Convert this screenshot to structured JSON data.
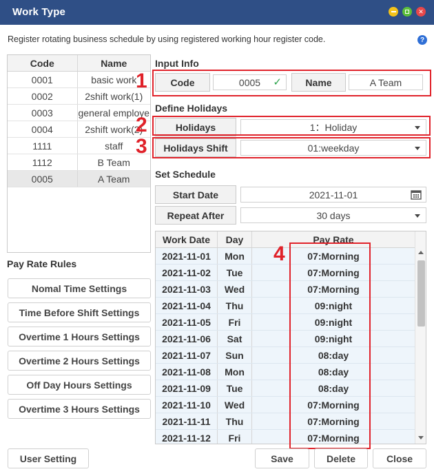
{
  "window": {
    "title": "Work Type"
  },
  "description": "Register rotating business schedule by using registered working hour register code.",
  "help_icon": "?",
  "code_list": {
    "headers": [
      "Code",
      "Name"
    ],
    "rows": [
      [
        "0001",
        "basic work"
      ],
      [
        "0002",
        "2shift work(1)"
      ],
      [
        "0003",
        "general employe"
      ],
      [
        "0004",
        "2shift work(2)"
      ],
      [
        "1111",
        "staff"
      ],
      [
        "1112",
        "B Team"
      ],
      [
        "0005",
        "A Team"
      ]
    ],
    "selected_index": 6
  },
  "pay_rate_rules": {
    "title": "Pay Rate Rules",
    "buttons": [
      "Nomal Time Settings",
      "Time Before Shift Settings",
      "Overtime 1 Hours Settings",
      "Overtime 2 Hours Settings",
      "Off Day Hours Settings",
      "Overtime 3 Hours Settings"
    ]
  },
  "input_info": {
    "title": "Input Info",
    "code_label": "Code",
    "code_value": "0005",
    "name_label": "Name",
    "name_value": "A Team"
  },
  "define_holidays": {
    "title": "Define Holidays",
    "holidays_label": "Holidays",
    "holidays_value": "1：Holiday",
    "shift_label": "Holidays Shift",
    "shift_value": "01:weekday"
  },
  "set_schedule": {
    "title": "Set Schedule",
    "start_label": "Start Date",
    "start_value": "2021-11-01",
    "repeat_label": "Repeat After",
    "repeat_value": "30 days"
  },
  "schedule_table": {
    "headers": [
      "Work Date",
      "Day",
      "Pay Rate"
    ],
    "rows": [
      [
        "2021-11-01",
        "Mon",
        "07:Morning"
      ],
      [
        "2021-11-02",
        "Tue",
        "07:Morning"
      ],
      [
        "2021-11-03",
        "Wed",
        "07:Morning"
      ],
      [
        "2021-11-04",
        "Thu",
        "09:night"
      ],
      [
        "2021-11-05",
        "Fri",
        "09:night"
      ],
      [
        "2021-11-06",
        "Sat",
        "09:night"
      ],
      [
        "2021-11-07",
        "Sun",
        "08:day"
      ],
      [
        "2021-11-08",
        "Mon",
        "08:day"
      ],
      [
        "2021-11-09",
        "Tue",
        "08:day"
      ],
      [
        "2021-11-10",
        "Wed",
        "07:Morning"
      ],
      [
        "2021-11-11",
        "Thu",
        "07:Morning"
      ],
      [
        "2021-11-12",
        "Fri",
        "07:Morning"
      ]
    ]
  },
  "annotations": [
    "1",
    "2",
    "3",
    "4"
  ],
  "buttons": {
    "user_setting": "User Setting",
    "save": "Save",
    "delete": "Delete",
    "close": "Close"
  },
  "colors": {
    "titlebar": "#2f4f86",
    "annotation_red": "#e0222a",
    "check_green": "#2aa24a",
    "row_highlight": "#eef5fb"
  }
}
